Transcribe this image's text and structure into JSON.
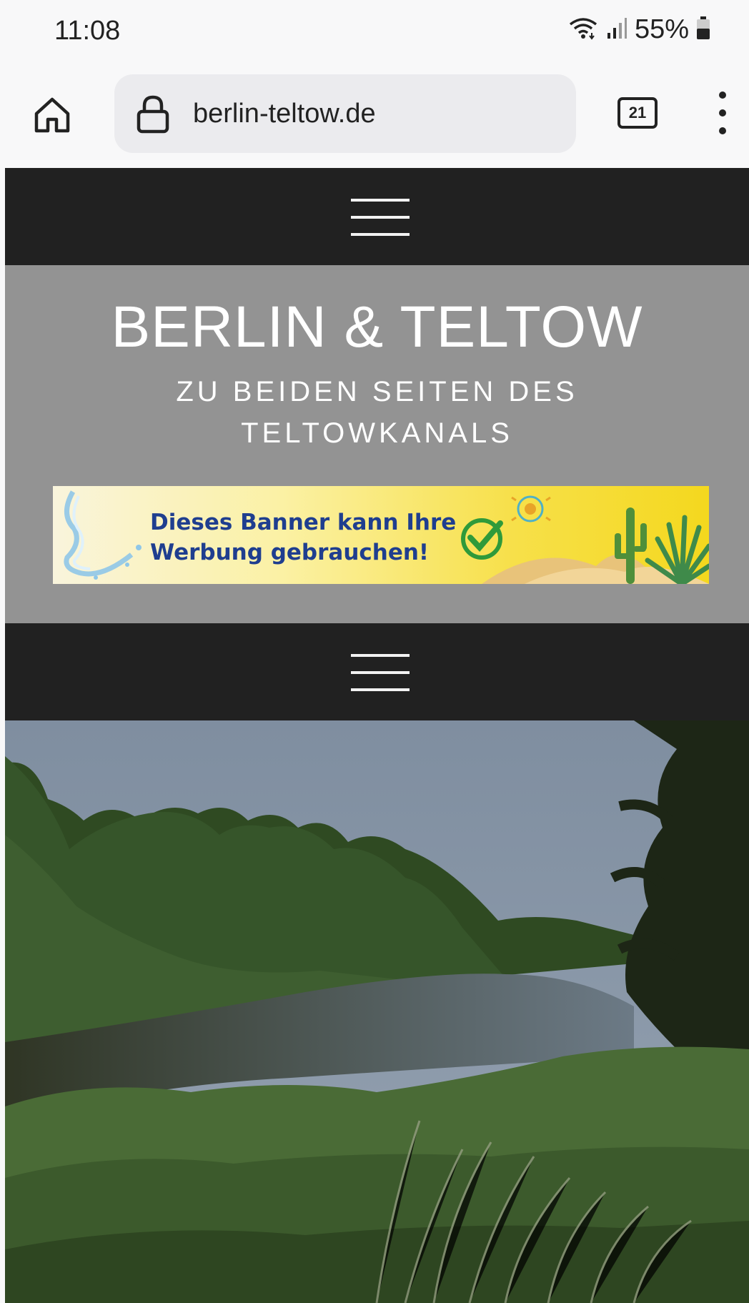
{
  "status_bar": {
    "time": "11:08",
    "battery": "55%",
    "icons": [
      "wifi-icon",
      "signal-icon",
      "battery-icon"
    ]
  },
  "browser": {
    "url": "berlin-teltow.de",
    "tab_count": "21",
    "icons": [
      "home-icon",
      "lock-icon",
      "tabs-icon",
      "more-vert-icon"
    ]
  },
  "site": {
    "title": "BERLIN & TELTOW",
    "subtitle": "ZU BEIDEN SEITEN DES TELTOWKANALS",
    "banner": {
      "line1": "Dieses Banner kann Ihre",
      "line2": "Werbung gebrauchen!"
    },
    "hero_image": "river-canal-landscape"
  },
  "colors": {
    "navbar": "#212121",
    "header": "#939393",
    "banner_text": "#1f3e8f",
    "banner_check": "#2f9a3a"
  }
}
